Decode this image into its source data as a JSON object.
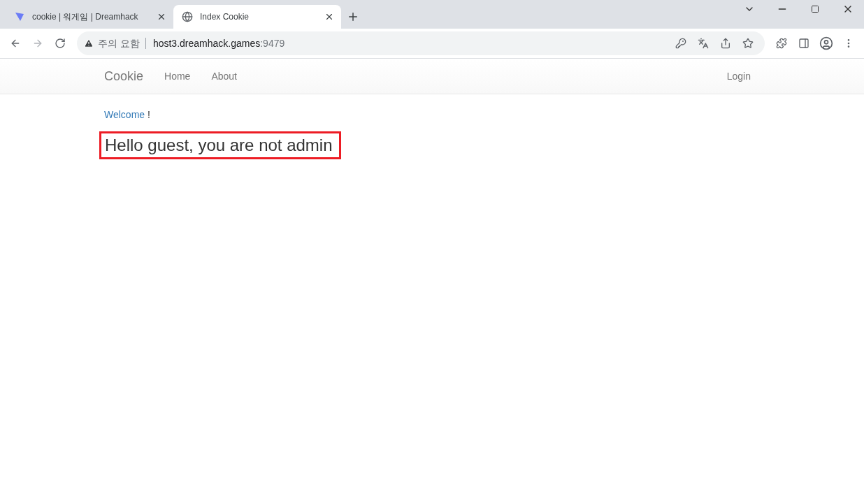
{
  "browser": {
    "tabs": [
      {
        "title": "cookie | 워게임 | Dreamhack",
        "selected": false,
        "kind": "brand"
      },
      {
        "title": "Index Cookie",
        "selected": true,
        "kind": "globe"
      }
    ],
    "address": {
      "security": "주의 요함",
      "host": "host3.dreamhack.games",
      "port": ":9479"
    }
  },
  "navbar": {
    "brand": "Cookie",
    "items": [
      "Home",
      "About"
    ],
    "right": [
      "Login"
    ]
  },
  "content": {
    "welcome_link": "Welcome",
    "welcome_mark": "!",
    "heading": "Hello guest, you are not admin",
    "heading_highlighted": true
  }
}
